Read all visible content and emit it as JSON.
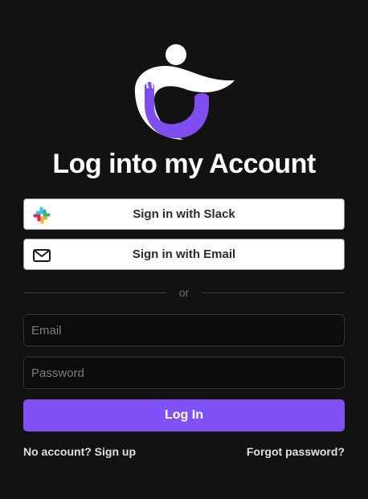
{
  "title": "Log into my Account",
  "sso": {
    "slack_label": "Sign in with Slack",
    "email_label": "Sign in with Email"
  },
  "divider_text": "or",
  "form": {
    "email_placeholder": "Email",
    "password_placeholder": "Password",
    "submit_label": "Log In"
  },
  "links": {
    "signup": "No account? Sign up",
    "forgot": "Forgot password?"
  },
  "icons": {
    "logo": "brand-logo",
    "slack": "slack-icon",
    "email": "mail-icon"
  },
  "colors": {
    "background": "#121212",
    "accent": "#8052f5",
    "button_bg": "#ffffff"
  }
}
